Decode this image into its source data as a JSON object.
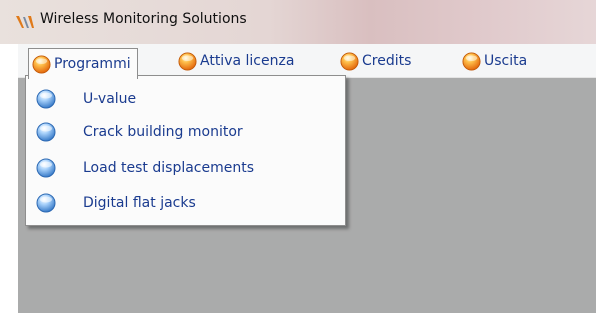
{
  "window": {
    "title": "Wireless Monitoring Solutions",
    "icon": "app-logo-icon"
  },
  "menu": {
    "items": [
      {
        "label": "Programmi",
        "icon": "orange-orb-icon",
        "active": true
      },
      {
        "label": "Attiva licenza",
        "icon": "orange-orb-icon"
      },
      {
        "label": "Credits",
        "icon": "orange-orb-icon"
      },
      {
        "label": "Uscita",
        "icon": "orange-orb-icon"
      }
    ]
  },
  "dropdown": {
    "items": [
      {
        "label": "U-value",
        "icon": "blue-orb-icon"
      },
      {
        "label": "Crack building monitor",
        "icon": "blue-orb-icon"
      },
      {
        "label": "Load test displacements",
        "icon": "blue-orb-icon"
      },
      {
        "label": "Digital flat jacks",
        "icon": "blue-orb-icon"
      }
    ]
  },
  "colors": {
    "menu_text": "#1a3b8f",
    "workspace": "#aaabab",
    "orange_orb": "#f28a1e",
    "blue_orb": "#4d8fd6"
  }
}
